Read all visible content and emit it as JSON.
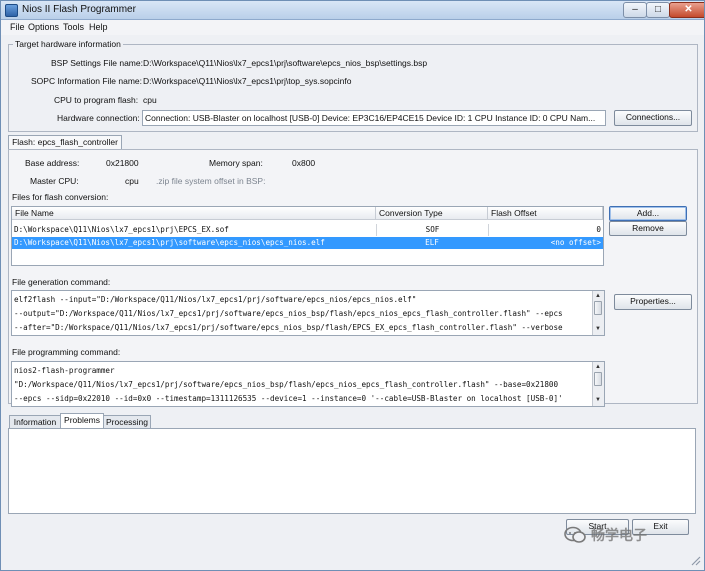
{
  "window": {
    "title": "Nios II Flash Programmer",
    "min": "–",
    "max": "□",
    "close": "✕"
  },
  "menu": [
    "File",
    "Options",
    "Tools",
    "Help"
  ],
  "target": {
    "group_title": "Target hardware information",
    "bsp_label": "BSP Settings File name:",
    "bsp_value": "D:\\Workspace\\Q11\\Nios\\lx7_epcs1\\prj\\software\\epcs_nios_bsp\\settings.bsp",
    "sopc_label": "SOPC Information File name:",
    "sopc_value": "D:\\Workspace\\Q11\\Nios\\lx7_epcs1\\prj\\top_sys.sopcinfo",
    "cpu_label": "CPU to program flash:",
    "cpu_value": "cpu",
    "hw_label": "Hardware connection:",
    "hw_value": "Connection: USB-Blaster on localhost [USB-0]    Device: EP3C16/EP4CE15    Device ID: 1    CPU Instance ID: 0    CPU Nam...",
    "connections_button": "Connections..."
  },
  "flash_tab": {
    "label": "Flash: epcs_flash_controller",
    "base_label": "Base address:",
    "base_value": "0x21800",
    "span_label": "Memory span:",
    "span_value": "0x800",
    "master_label": "Master CPU:",
    "master_value": "cpu",
    "zip_label": ".zip file system offset in BSP:"
  },
  "files": {
    "section_label": "Files for flash conversion:",
    "columns": [
      "File Name",
      "Conversion Type",
      "Flash Offset"
    ],
    "rows": [
      {
        "name": "D:\\Workspace\\Q11\\Nios\\lx7_epcs1\\prj\\EPCS_EX.sof",
        "type": "SOF",
        "offset": "0",
        "selected": false
      },
      {
        "name": "D:\\Workspace\\Q11\\Nios\\lx7_epcs1\\prj\\software\\epcs_nios\\epcs_nios.elf",
        "type": "ELF",
        "offset": "<no offset>",
        "selected": true
      }
    ],
    "add_button": "Add...",
    "remove_button": "Remove"
  },
  "generation": {
    "section_label": "File generation command:",
    "lines": [
      "elf2flash --input=\"D:/Workspace/Q11/Nios/lx7_epcs1/prj/software/epcs_nios/epcs_nios.elf\"",
      "--output=\"D:/Workspace/Q11/Nios/lx7_epcs1/prj/software/epcs_nios_bsp/flash/epcs_nios_epcs_flash_controller.flash\" --epcs",
      "--after=\"D:/Workspace/Q11/Nios/lx7_epcs1/prj/software/epcs_nios_bsp/flash/EPCS_EX_epcs_flash_controller.flash\" --verbose"
    ],
    "properties_button": "Properties..."
  },
  "programming": {
    "section_label": "File programming command:",
    "lines": [
      "nios2-flash-programmer",
      "\"D:/Workspace/Q11/Nios/lx7_epcs1/prj/software/epcs_nios_bsp/flash/epcs_nios_epcs_flash_controller.flash\" --base=0x21800",
      "--epcs --sidp=0x22010 --id=0x0 --timestamp=1311126535 --device=1 --instance=0 '--cable=USB-Blaster on localhost [USB-0]'"
    ]
  },
  "bottom_tabs": [
    "Information",
    "Problems",
    "Processing"
  ],
  "active_bottom_tab": 1,
  "footer": {
    "start_button": "Start",
    "exit_button": "Exit"
  },
  "watermark": {
    "text": "畅学电子"
  },
  "colors": {
    "selection": "#3399ff",
    "title_gradient_top": "#d9e6f6",
    "title_gradient_bottom": "#b9cfe9"
  }
}
